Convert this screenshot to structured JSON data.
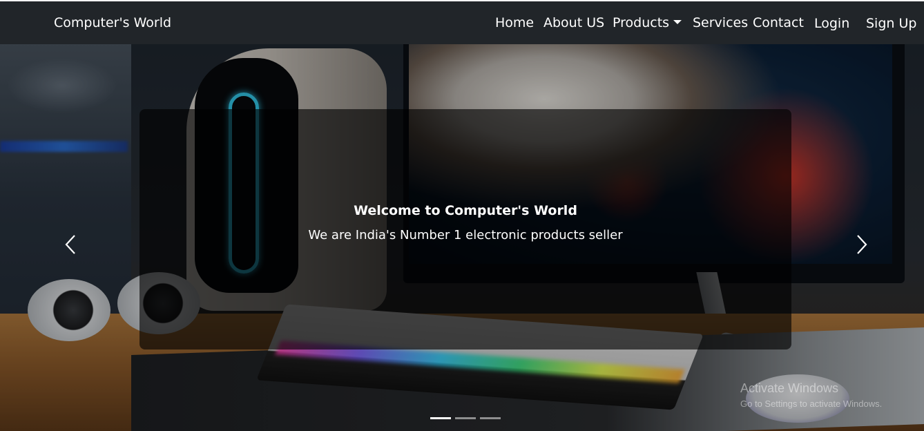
{
  "navbar": {
    "brand": "Computer's World",
    "links": {
      "home": "Home",
      "about": "About US",
      "products": "Products",
      "services": "Services",
      "contact": "Contact",
      "login": "Login",
      "signup": "Sign Up"
    }
  },
  "carousel": {
    "caption_title": "Welcome to Computer's World",
    "caption_text": "We are India's Number 1 electronic products seller",
    "prev_icon": "chevron-left-icon",
    "next_icon": "chevron-right-icon",
    "indicators": 3,
    "active_indicator": 1
  },
  "watermark": {
    "title": "Activate Windows",
    "subtitle": "Go to Settings to activate Windows."
  },
  "colors": {
    "navbar_bg": "#212529",
    "text": "#ffffff"
  }
}
